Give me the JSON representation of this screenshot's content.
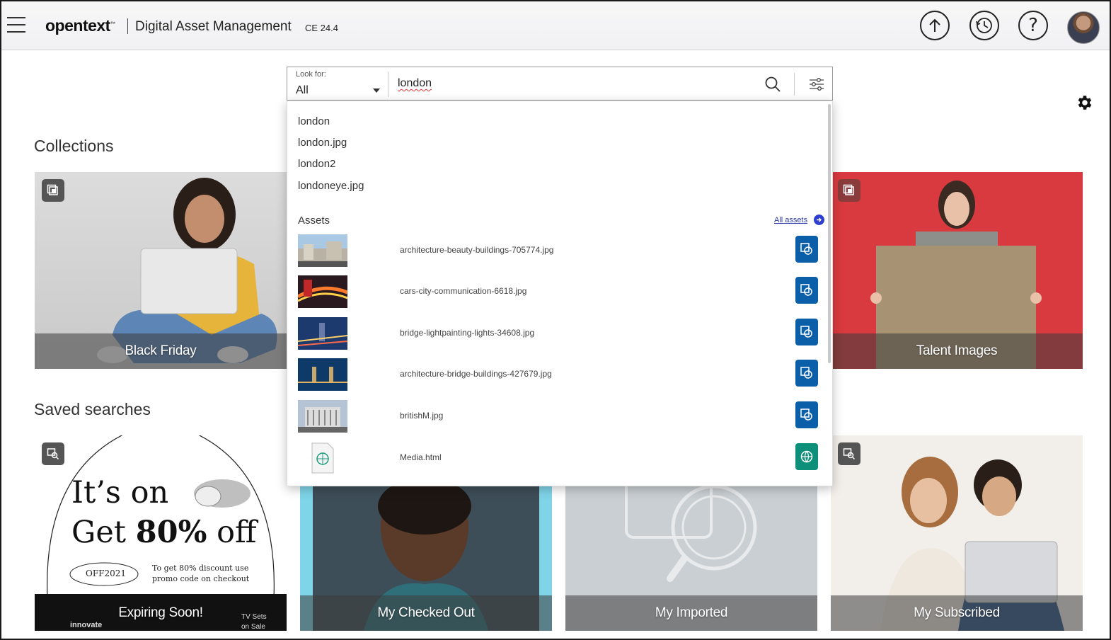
{
  "header": {
    "brand": "opentext",
    "brand_tm": "™",
    "product": "Digital Asset Management",
    "version": "CE 24.4",
    "icons": [
      "hamburger-menu-icon",
      "upload-icon",
      "history-icon",
      "help-icon",
      "user-avatar"
    ]
  },
  "search": {
    "look_for_label": "Look for:",
    "look_for_value": "All",
    "query": "london"
  },
  "suggestions": [
    "london",
    "london.jpg",
    "london2",
    "londoneye.jpg"
  ],
  "assets": {
    "title": "Assets",
    "all_assets_label": "All assets",
    "items": [
      {
        "name": "architecture-beauty-buildings-705774.jpg",
        "kind": "image"
      },
      {
        "name": "cars-city-communication-6618.jpg",
        "kind": "image"
      },
      {
        "name": "bridge-lightpainting-lights-34608.jpg",
        "kind": "image"
      },
      {
        "name": "architecture-bridge-buildings-427679.jpg",
        "kind": "image"
      },
      {
        "name": "britishM.jpg",
        "kind": "image"
      },
      {
        "name": "Media.html",
        "kind": "html"
      }
    ]
  },
  "collections": {
    "title": "Collections",
    "items": [
      {
        "label": "Black Friday"
      },
      {
        "label": "Talent Images"
      }
    ]
  },
  "saved_searches": {
    "title": "Saved searches",
    "items": [
      {
        "label": "Expiring Soon!"
      },
      {
        "label": "My Checked Out"
      },
      {
        "label": "My Imported"
      },
      {
        "label": "My Subscribed"
      }
    ]
  },
  "promo": {
    "line1": "It’s on",
    "line2a": "Get ",
    "line2b": "80%",
    "line2c": " off",
    "code": "OFF2021",
    "note1": "To get 80% discount use",
    "note2": "promo code on checkout",
    "footer_brand": "innovate",
    "footer_right": "TV Sets",
    "footer_right2": "on Sale"
  },
  "colors": {
    "action_blue": "#0b5fa8",
    "action_teal": "#0e8f7a",
    "link_blue": "#2a3aa8"
  }
}
